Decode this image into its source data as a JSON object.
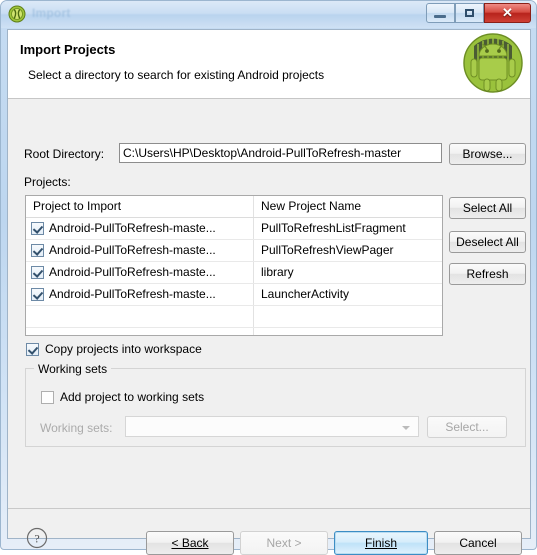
{
  "window": {
    "title": "Import",
    "icon": "eclipse-icon",
    "controls": {
      "minimize": "minimize-icon",
      "maximize": "restore-icon",
      "close": "✕"
    }
  },
  "header": {
    "title": "Import Projects",
    "subtitle": "Select a directory to search for existing Android projects",
    "logo": "android-robot-icon"
  },
  "form": {
    "root_directory_label": "Root Directory:",
    "root_directory_value": "C:\\Users\\HP\\Desktop\\Android-PullToRefresh-master",
    "root_directory_placeholder": "",
    "browse_label": "Browse...",
    "projects_label": "Projects:"
  },
  "table": {
    "columns": [
      "Project to Import",
      "New Project Name"
    ],
    "rows": [
      {
        "checked": true,
        "project": "Android-PullToRefresh-maste...",
        "new_name": "PullToRefreshListFragment"
      },
      {
        "checked": true,
        "project": "Android-PullToRefresh-maste...",
        "new_name": "PullToRefreshViewPager"
      },
      {
        "checked": true,
        "project": "Android-PullToRefresh-maste...",
        "new_name": "library"
      },
      {
        "checked": true,
        "project": "Android-PullToRefresh-maste...",
        "new_name": "LauncherActivity"
      }
    ]
  },
  "side_buttons": {
    "select_all": "Select All",
    "deselect_all": "Deselect All",
    "refresh": "Refresh"
  },
  "options": {
    "copy_projects_label": "Copy projects into workspace",
    "copy_projects_checked": true,
    "working_sets_group_title": "Working sets",
    "add_project_label": "Add project to working sets",
    "add_project_checked": false,
    "working_sets_label": "Working sets:",
    "working_sets_value": "",
    "working_sets_select_label": "Select..."
  },
  "footer": {
    "help": "?",
    "back": "< Back",
    "next": "Next >",
    "finish": "Finish",
    "cancel": "Cancel"
  },
  "colors": {
    "accent": "#3c8dc4",
    "close_button": "#b7231c",
    "android_green": "#a4c639",
    "titlebar": "#cadef3",
    "dialog_bg": "#f0f0f0"
  }
}
